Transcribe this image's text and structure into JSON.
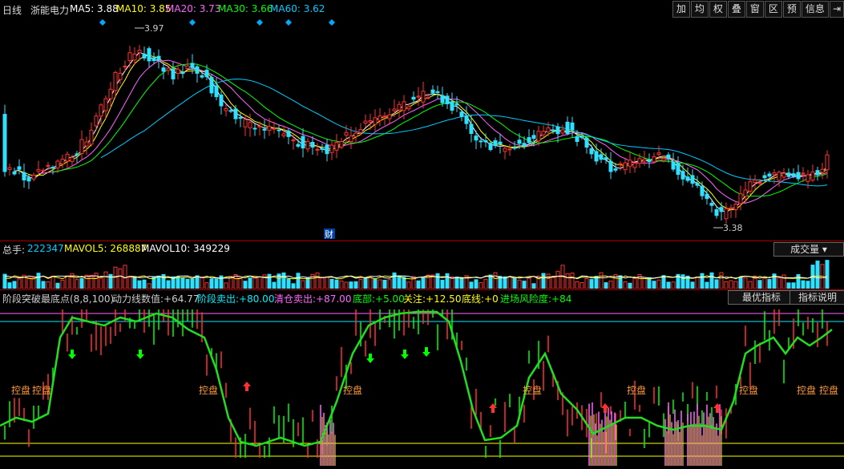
{
  "header": {
    "period": "日线",
    "stock_name": "浙能电力",
    "ma": [
      {
        "label": "MA5: 3.88",
        "color": "#ffffff"
      },
      {
        "label": "MA10: 3.85",
        "color": "#ffff00"
      },
      {
        "label": "MA20: 3.73",
        "color": "#ff66ff"
      },
      {
        "label": "MA30: 3.66",
        "color": "#00ff00"
      },
      {
        "label": "MA60: 3.62",
        "color": "#00ccff"
      }
    ],
    "buttons": [
      "加",
      "均",
      "权",
      "叠",
      "窗",
      "区",
      "预",
      "信息"
    ],
    "back_icon": "back-arrow-icon"
  },
  "price_chart": {
    "high_label": "3.97",
    "low_label": "3.38",
    "fin_marker": "财"
  },
  "volume_panel": {
    "total_label": "总手:",
    "total_value": "222347",
    "mavol5": "MAVOL5: 268887",
    "mavol10": "MAVOL10: 349229",
    "selector": "成交量"
  },
  "indicator_panel": {
    "name": "阶段突破最底点(8,8,100)",
    "items": [
      {
        "label": "动力线数值:",
        "value": "+64.77",
        "color": "#cccccc"
      },
      {
        "label": "阶段卖出:",
        "value": "+80.00",
        "color": "#00e5ff"
      },
      {
        "label": "清仓卖出:",
        "value": "+87.00",
        "color": "#ff66ff"
      },
      {
        "label": "底部:",
        "value": "+5.00",
        "color": "#00ff00"
      },
      {
        "label": "关注:",
        "value": "+12.50",
        "color": "#ffff00"
      },
      {
        "label": "底线:",
        "value": "+0",
        "color": "#ffff00"
      },
      {
        "label": "进场风险度:",
        "value": "+84",
        "color": "#00ff00"
      }
    ],
    "best_button": "最优指标",
    "help_button": "指标说明",
    "kongpan_label": "控盘"
  },
  "colors": {
    "up": "#ff3030",
    "down": "#30e0ff",
    "ma5": "#ffffff",
    "ma10": "#ffff00",
    "ma20": "#ff66ff",
    "ma30": "#00ff00",
    "ma60": "#00ccff"
  }
}
